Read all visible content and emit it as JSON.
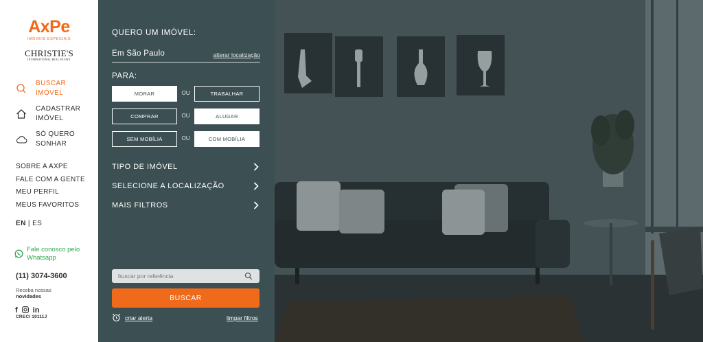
{
  "brand": {
    "name": "AxPe",
    "tagline": "IMÓVEIS ESPECIAIS",
    "partner": "CHRISTIE'S",
    "partner_sub": "INTERNATIONAL REAL ESTATE"
  },
  "sidebar": {
    "nav": [
      {
        "label": "BUSCAR IMÓVEL",
        "icon": "search-icon",
        "active": true
      },
      {
        "label": "CADASTRAR IMÓVEL",
        "icon": "house-icon",
        "active": false
      },
      {
        "label": "SÓ QUERO SONHAR",
        "icon": "cloud-icon",
        "active": false
      }
    ],
    "links": [
      "SOBRE A AXPE",
      "FALE COM A GENTE",
      "MEU PERFIL",
      "MEUS FAVORITOS"
    ],
    "lang": {
      "current": "EN",
      "separator": "|",
      "other": "ES"
    },
    "whatsapp": "Fale conosco pelo Whatsapp",
    "phone": "(11) 3074-3600",
    "newsletter_1": "Receba nossas",
    "newsletter_2": "novidades",
    "social": [
      "facebook-icon",
      "instagram-icon",
      "linkedin-icon"
    ],
    "creci": "CRECI 19111J"
  },
  "panel": {
    "heading": "QUERO UM IMÓVEL:",
    "location": "Em São Paulo",
    "change_location": "alterar localização",
    "para": "PARA:",
    "options": [
      {
        "left": "MORAR",
        "right": "TRABALHAR",
        "or": "OU",
        "selected": "left"
      },
      {
        "left": "COMPRAR",
        "right": "ALUGAR",
        "or": "OU",
        "selected": "right"
      },
      {
        "left": "SEM MOBÍLIA",
        "right": "COM MOBÍLIA",
        "or": "OU",
        "selected": "right"
      }
    ],
    "expanders": [
      "TIPO DE IMÓVEL",
      "SELECIONE A LOCALIZAÇÃO",
      "MAIS FILTROS"
    ],
    "search_placeholder": "buscar por referência",
    "submit": "BUSCAR",
    "alert": "criar alerta",
    "clear": "limpar filtros"
  },
  "colors": {
    "accent": "#f06a1b",
    "panel": "#3c4f52",
    "whatsapp": "#2fa84f"
  }
}
